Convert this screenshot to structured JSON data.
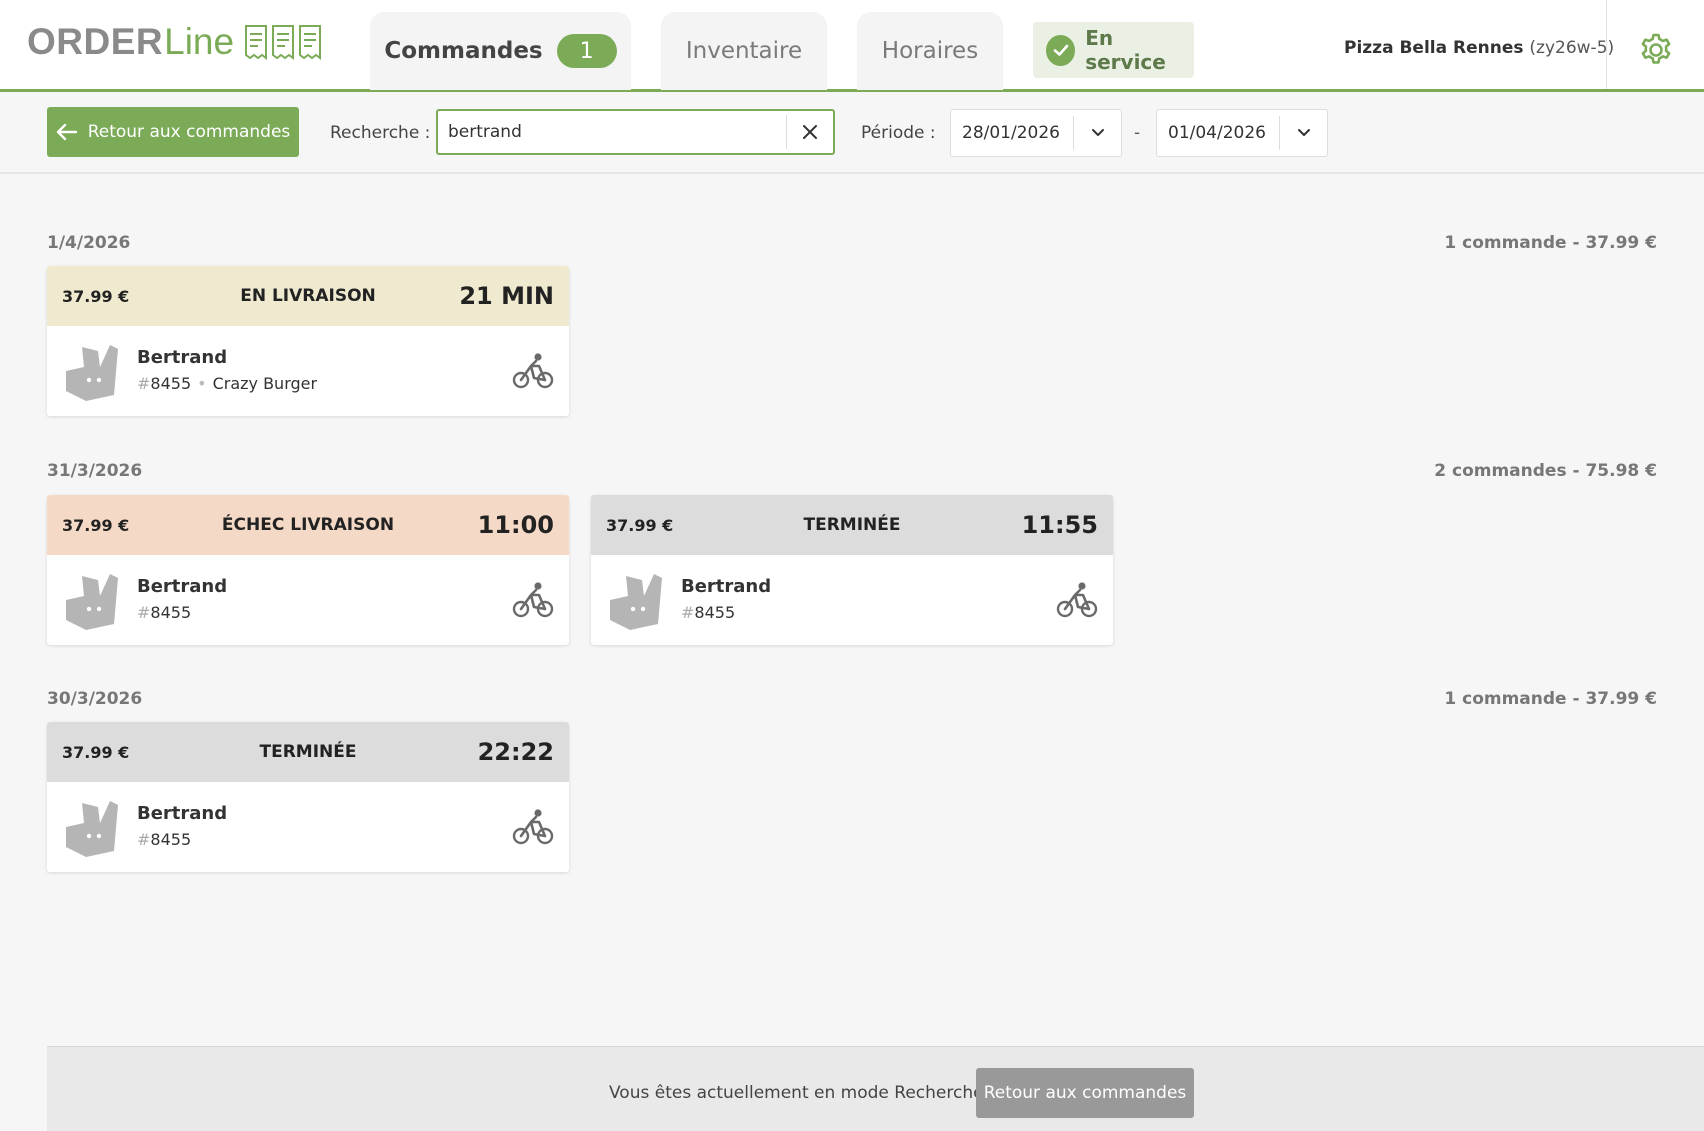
{
  "brand": {
    "logo_order": "ORDER",
    "logo_line": "Line",
    "accent": "#7bab57"
  },
  "tabs": [
    {
      "label": "Commandes",
      "badge": "1",
      "active": true
    },
    {
      "label": "Inventaire"
    },
    {
      "label": "Horaires"
    }
  ],
  "service": {
    "label": "En service",
    "icon": "check-circle-icon"
  },
  "shop": {
    "name": "Pizza Bella Rennes",
    "code": "(zy26w-5)"
  },
  "settings_icon": "gear-icon",
  "toolbar": {
    "back_label": "Retour aux commandes",
    "search_label": "Recherche :",
    "search_value": "bertrand",
    "period_label": "Période :",
    "date_from": "28/01/2026",
    "date_separator": "-",
    "date_to": "01/04/2026"
  },
  "days": [
    {
      "date": "1/4/2026",
      "summary": "1 commande - 37.99 €",
      "orders": [
        {
          "price": "37.99 €",
          "status": "EN LIVRAISON",
          "time": "21 MIN",
          "state": "delivery",
          "customer": "Bertrand",
          "hash": "#",
          "number": "8455",
          "extra": "Crazy Burger"
        }
      ]
    },
    {
      "date": "31/3/2026",
      "summary": "2 commandes - 75.98 €",
      "orders": [
        {
          "price": "37.99 €",
          "status": "ÉCHEC LIVRAISON",
          "time": "11:00",
          "state": "failed",
          "customer": "Bertrand",
          "hash": "#",
          "number": "8455"
        },
        {
          "price": "37.99 €",
          "status": "TERMINÉE",
          "time": "11:55",
          "state": "done",
          "customer": "Bertrand",
          "hash": "#",
          "number": "8455"
        }
      ]
    },
    {
      "date": "30/3/2026",
      "summary": "1 commande - 37.99 €",
      "orders": [
        {
          "price": "37.99 €",
          "status": "TERMINÉE",
          "time": "22:22",
          "state": "done",
          "customer": "Bertrand",
          "hash": "#",
          "number": "8455"
        }
      ]
    }
  ],
  "footer": {
    "message": "Vous êtes actuellement en mode Recherche.",
    "button_label": "Retour aux commandes"
  }
}
